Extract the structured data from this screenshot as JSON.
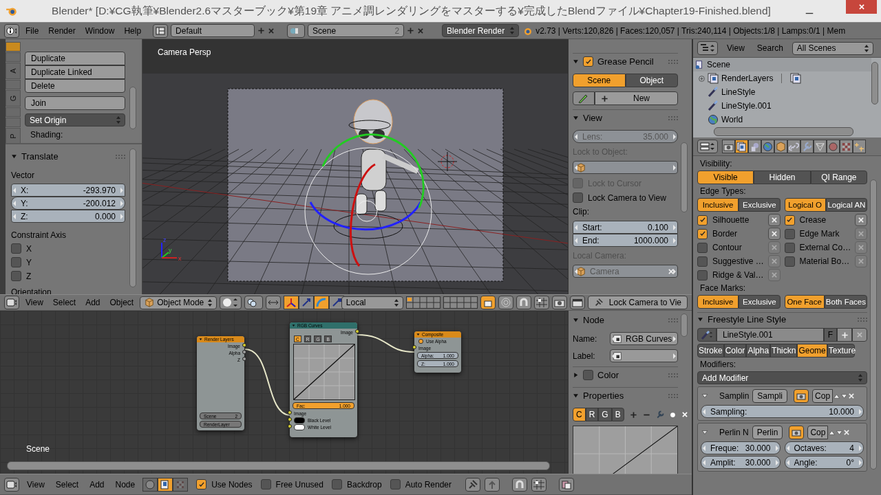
{
  "window": {
    "title": "Blender* [D:¥CG執筆¥Blender2.6マスターブック¥第19章 アニメ調レンダリングをマスターする¥完成したBlendファイル¥Chapter19-Finished.blend]"
  },
  "info_header": {
    "menus": [
      "File",
      "Render",
      "Window",
      "Help"
    ],
    "layout": "Default",
    "scene": "Scene",
    "scene_users": "2",
    "engine": "Blender Render",
    "stats": "v2.73 | Verts:120,826 | Faces:120,057 | Tris:240,114 | Objects:1/8 | Lamps:0/1 | Mem"
  },
  "toolshelf": {
    "tabs": [
      {
        "selected": true
      },
      {
        "selected": false
      },
      {
        "label": "A",
        "selected": false
      },
      {
        "selected": false
      },
      {
        "label": "G",
        "selected": false
      },
      {
        "selected": false
      },
      {
        "selected": false
      },
      {
        "label": "P",
        "selected": false
      }
    ],
    "buttons": [
      "Duplicate",
      "Duplicate Linked",
      "Delete"
    ],
    "join": "Join",
    "set_origin": "Set Origin",
    "shading_label": "Shading:"
  },
  "operator": {
    "title": "Translate",
    "vector_label": "Vector",
    "vector": [
      {
        "label": "X:",
        "value": "-293.970"
      },
      {
        "label": "Y:",
        "value": "-200.012"
      },
      {
        "label": "Z:",
        "value": "0.000"
      }
    ],
    "constraint_label": "Constraint Axis",
    "axes": [
      {
        "label": "X",
        "checked": false
      },
      {
        "label": "Y",
        "checked": false
      },
      {
        "label": "Z",
        "checked": false
      }
    ],
    "orientation_label": "Orientation"
  },
  "viewport": {
    "label": "Camera Persp",
    "axis_labels": [
      "z",
      "y",
      "x"
    ]
  },
  "view3d_panel": {
    "grease_pencil": {
      "title": "Grease Pencil",
      "checked": true,
      "sources": [
        {
          "label": "Scene",
          "selected": true
        },
        {
          "label": "Object",
          "selected": false
        }
      ],
      "new": "New"
    },
    "view": {
      "title": "View",
      "lens_label": "Lens:",
      "lens": "35.000",
      "lock_object_label": "Lock to Object:",
      "locks": [
        {
          "label": "Lock to Cursor",
          "checked": false,
          "disabled": true
        },
        {
          "label": "Lock Camera to View",
          "checked": false,
          "disabled": false
        }
      ],
      "clip_label": "Clip:",
      "clip": [
        {
          "label": "Start:",
          "value": "0.100"
        },
        {
          "label": "End:",
          "value": "1000.000"
        }
      ],
      "local_camera_label": "Local Camera:",
      "local_camera": "Camera"
    }
  },
  "view3d_header": {
    "menus": [
      "View",
      "Select",
      "Add",
      "Object"
    ],
    "mode": "Object Mode",
    "transform_widgets": [
      {
        "kind": "combined",
        "on": true
      },
      {
        "kind": "translate",
        "on": false
      },
      {
        "kind": "rotate",
        "on": true
      },
      {
        "kind": "scale",
        "on": false
      }
    ],
    "orientation": "Local",
    "lock_button": "Lock Camera to Vie"
  },
  "nodes": [
    {
      "kind": "input",
      "title": "Render Layers",
      "outputs": [
        {
          "name": "Image",
          "kind": "color"
        },
        {
          "name": "Alpha",
          "kind": "value"
        },
        {
          "name": "Z",
          "kind": "value"
        }
      ],
      "scene": "Scene",
      "scene_users": "2",
      "layer": "RenderLayer"
    },
    {
      "kind": "color",
      "title": "RGB Curves",
      "outputs": [
        {
          "name": "Image",
          "kind": "color"
        }
      ],
      "channels": [
        {
          "label": "C",
          "selected": true
        },
        {
          "label": "R",
          "selected": false
        },
        {
          "label": "G",
          "selected": false
        },
        {
          "label": "B",
          "selected": false
        }
      ],
      "fac_label": "Fac:",
      "fac": "1.000",
      "inputs": [
        {
          "name": "Image",
          "kind": "color"
        },
        {
          "name": "Black Level",
          "kind": "color"
        },
        {
          "name": "White Level",
          "kind": "color"
        }
      ]
    },
    {
      "kind": "output",
      "title": "Composite",
      "use_alpha": "Use Alpha",
      "inputs": [
        {
          "name": "Image",
          "kind": "color"
        }
      ],
      "fields": [
        {
          "label": "Alpha:",
          "value": "1.000"
        },
        {
          "label": "Z:",
          "value": "1.000"
        }
      ]
    }
  ],
  "node_canvas": {
    "label": "Scene"
  },
  "node_panel": {
    "title": "Node",
    "name_label": "Name:",
    "name": "RGB Curves",
    "label_label": "Label:",
    "color": {
      "title": "Color",
      "checked": false
    },
    "properties": {
      "title": "Properties",
      "channels": [
        {
          "label": "C",
          "selected": true
        },
        {
          "label": "R",
          "selected": false
        },
        {
          "label": "G",
          "selected": false
        },
        {
          "label": "B",
          "selected": false
        }
      ]
    }
  },
  "node_header": {
    "menus": [
      "View",
      "Select",
      "Add",
      "Node"
    ],
    "tree_types": [
      {
        "kind": "shader",
        "selected": false
      },
      {
        "kind": "compositing",
        "selected": true
      },
      {
        "kind": "texture",
        "selected": false
      }
    ],
    "options": [
      {
        "label": "Use Nodes",
        "checked": true
      },
      {
        "label": "Free Unused",
        "checked": false
      },
      {
        "label": "Backdrop",
        "checked": false
      },
      {
        "label": "Auto Render",
        "checked": false
      }
    ]
  },
  "outliner": {
    "menus": [
      "View",
      "Search"
    ],
    "filter": "All Scenes",
    "tree": [
      {
        "label": "Scene",
        "kind": "scene",
        "children": [
          {
            "label": "RenderLayers",
            "kind": "render_layers",
            "expanded": false
          },
          {
            "label": "LineStyle",
            "kind": "linestyle"
          },
          {
            "label": "LineStyle.001",
            "kind": "linestyle"
          },
          {
            "label": "World",
            "kind": "world"
          }
        ]
      }
    ]
  },
  "properties": {
    "context_tabs": [
      {
        "kind": "render",
        "selected": false
      },
      {
        "kind": "render_layers",
        "selected": true
      },
      {
        "kind": "scene",
        "selected": false
      },
      {
        "kind": "world",
        "selected": false
      },
      {
        "kind": "object",
        "selected": false
      },
      {
        "kind": "constraints",
        "selected": false
      },
      {
        "kind": "modifiers",
        "selected": false
      },
      {
        "kind": "data",
        "selected": false
      },
      {
        "kind": "material",
        "selected": false
      },
      {
        "kind": "texture",
        "selected": false
      },
      {
        "kind": "particles",
        "selected": false
      }
    ],
    "visibility_label": "Visibility:",
    "visibility": [
      {
        "label": "Visible",
        "selected": true
      },
      {
        "label": "Hidden",
        "selected": false
      },
      {
        "label": "QI Range",
        "selected": false
      }
    ],
    "edge_types_label": "Edge Types:",
    "edge_mode": [
      {
        "label": "Inclusive",
        "selected": true
      },
      {
        "label": "Exclusive",
        "selected": false
      }
    ],
    "edge_logic": [
      {
        "label": "Logical O",
        "selected": true
      },
      {
        "label": "Logical AN",
        "selected": false
      }
    ],
    "edges": [
      {
        "label": "Silhouette",
        "checked": true
      },
      {
        "label": "Crease",
        "checked": true
      },
      {
        "label": "Border",
        "checked": true
      },
      {
        "label": "Edge Mark",
        "checked": false
      },
      {
        "label": "Contour",
        "checked": false
      },
      {
        "label": "External Co…",
        "checked": false
      },
      {
        "label": "Suggestive …",
        "checked": false
      },
      {
        "label": "Material Bo…",
        "checked": false
      },
      {
        "label": "Ridge & Val…",
        "checked": false
      }
    ],
    "face_marks_label": "Face Marks:",
    "face_mode": [
      {
        "label": "Inclusive",
        "selected": true
      },
      {
        "label": "Exclusive",
        "selected": false
      }
    ],
    "face_condition": [
      {
        "label": "One Face",
        "selected": true
      },
      {
        "label": "Both Faces",
        "selected": false
      }
    ],
    "line_style": {
      "title": "Freestyle Line Style",
      "name": "LineStyle.001",
      "fake_user": "F",
      "tabs": [
        {
          "label": "Stroke",
          "selected": false
        },
        {
          "label": "Color",
          "selected": false
        },
        {
          "label": "Alpha",
          "selected": false
        },
        {
          "label": "Thickn",
          "selected": false
        },
        {
          "label": "Geome",
          "selected": true
        },
        {
          "label": "Texture",
          "selected": false
        }
      ],
      "modifiers_label": "Modifiers:",
      "add_modifier": "Add Modifier",
      "modifiers": [
        {
          "name": "Samplin",
          "type": "Sampli",
          "copy": "Cop",
          "fields": [
            {
              "label": "Sampling:",
              "value": "10.000"
            }
          ]
        },
        {
          "name": "Perlin N",
          "type": "Perlin",
          "copy": "Cop",
          "fields": [
            {
              "label": "Freque:",
              "value": "30.000"
            },
            {
              "label": "Octaves:",
              "value": "4"
            },
            {
              "label": "Amplit:",
              "value": "30.000"
            },
            {
              "label": "Angle:",
              "value": "0°"
            }
          ]
        }
      ]
    }
  }
}
